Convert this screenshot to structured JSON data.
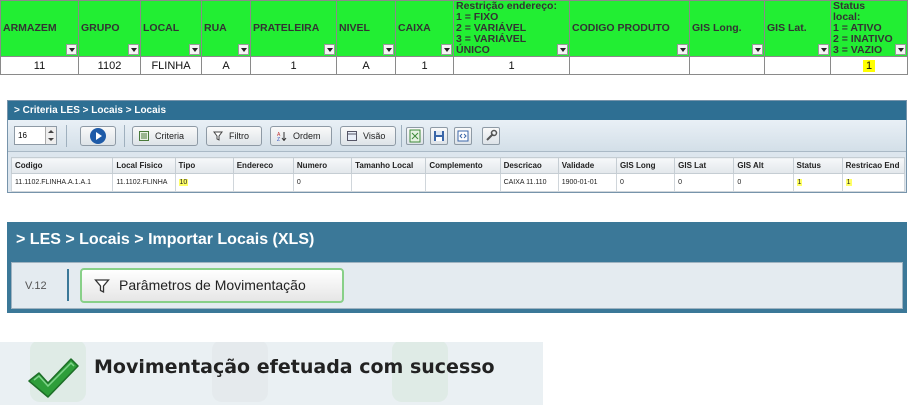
{
  "spreadsheet": {
    "headers": [
      "ARMAZEM",
      "GRUPO",
      "LOCAL",
      "RUA",
      "PRATELEIRA",
      "NIVEL",
      "CAIXA",
      "Restrição endereço:\n1 = FIXO\n2 = VARIÁVEL\n3 = VARIÁVEL ÚNICO",
      "CODIGO PRODUTO",
      "GIS Long.",
      "GIS Lat.",
      "Status local:\n1 = ATIVO\n2 = INATIVO\n3 = VAZIO"
    ],
    "row": [
      "11",
      "1102",
      "FLINHA",
      "A",
      "1",
      "A",
      "1",
      "1",
      "",
      "",
      "",
      "1"
    ]
  },
  "les_grid": {
    "breadcrumb": "> Criteria LES > Locais > Locais",
    "page_size": "16",
    "buttons": {
      "criteria": "Criteria",
      "filtro": "Filtro",
      "ordem": "Ordem",
      "visao": "Visão"
    },
    "columns": [
      "Codigo",
      "Local Fisico",
      "Tipo",
      "Endereco",
      "Numero",
      "Tamanho Local",
      "Complemento",
      "Descricao",
      "Validade",
      "GIS Long",
      "GIS Lat",
      "GIS Alt",
      "Status",
      "Restricao End"
    ],
    "row": [
      "11.1102.FLINHA.A.1.A.1",
      "11.1102.FLINHA",
      "10",
      "",
      "0",
      "",
      "",
      "CAIXA 11.110",
      "1900-01-01",
      "0",
      "0",
      "0",
      "1",
      "1"
    ]
  },
  "import_panel": {
    "breadcrumb": "> LES > Locais > Importar Locais (XLS)",
    "version": "V.12",
    "button_label": "Parâmetros de Movimentação"
  },
  "success_message": {
    "text": "Movimentação efetuada com sucesso"
  },
  "colors": {
    "sheet_header": "#22ee33",
    "highlight": "#ffff00",
    "les_titlebar": "#2e6f93",
    "import_titlebar": "#3b7898",
    "check_green": "#2e9e3a"
  },
  "icons": [
    "play-icon",
    "criteria-icon",
    "filter-icon",
    "sort-icon",
    "view-icon",
    "excel-icon",
    "save-icon",
    "code-icon",
    "tool-icon",
    "funnel-icon",
    "checkmark-icon"
  ]
}
